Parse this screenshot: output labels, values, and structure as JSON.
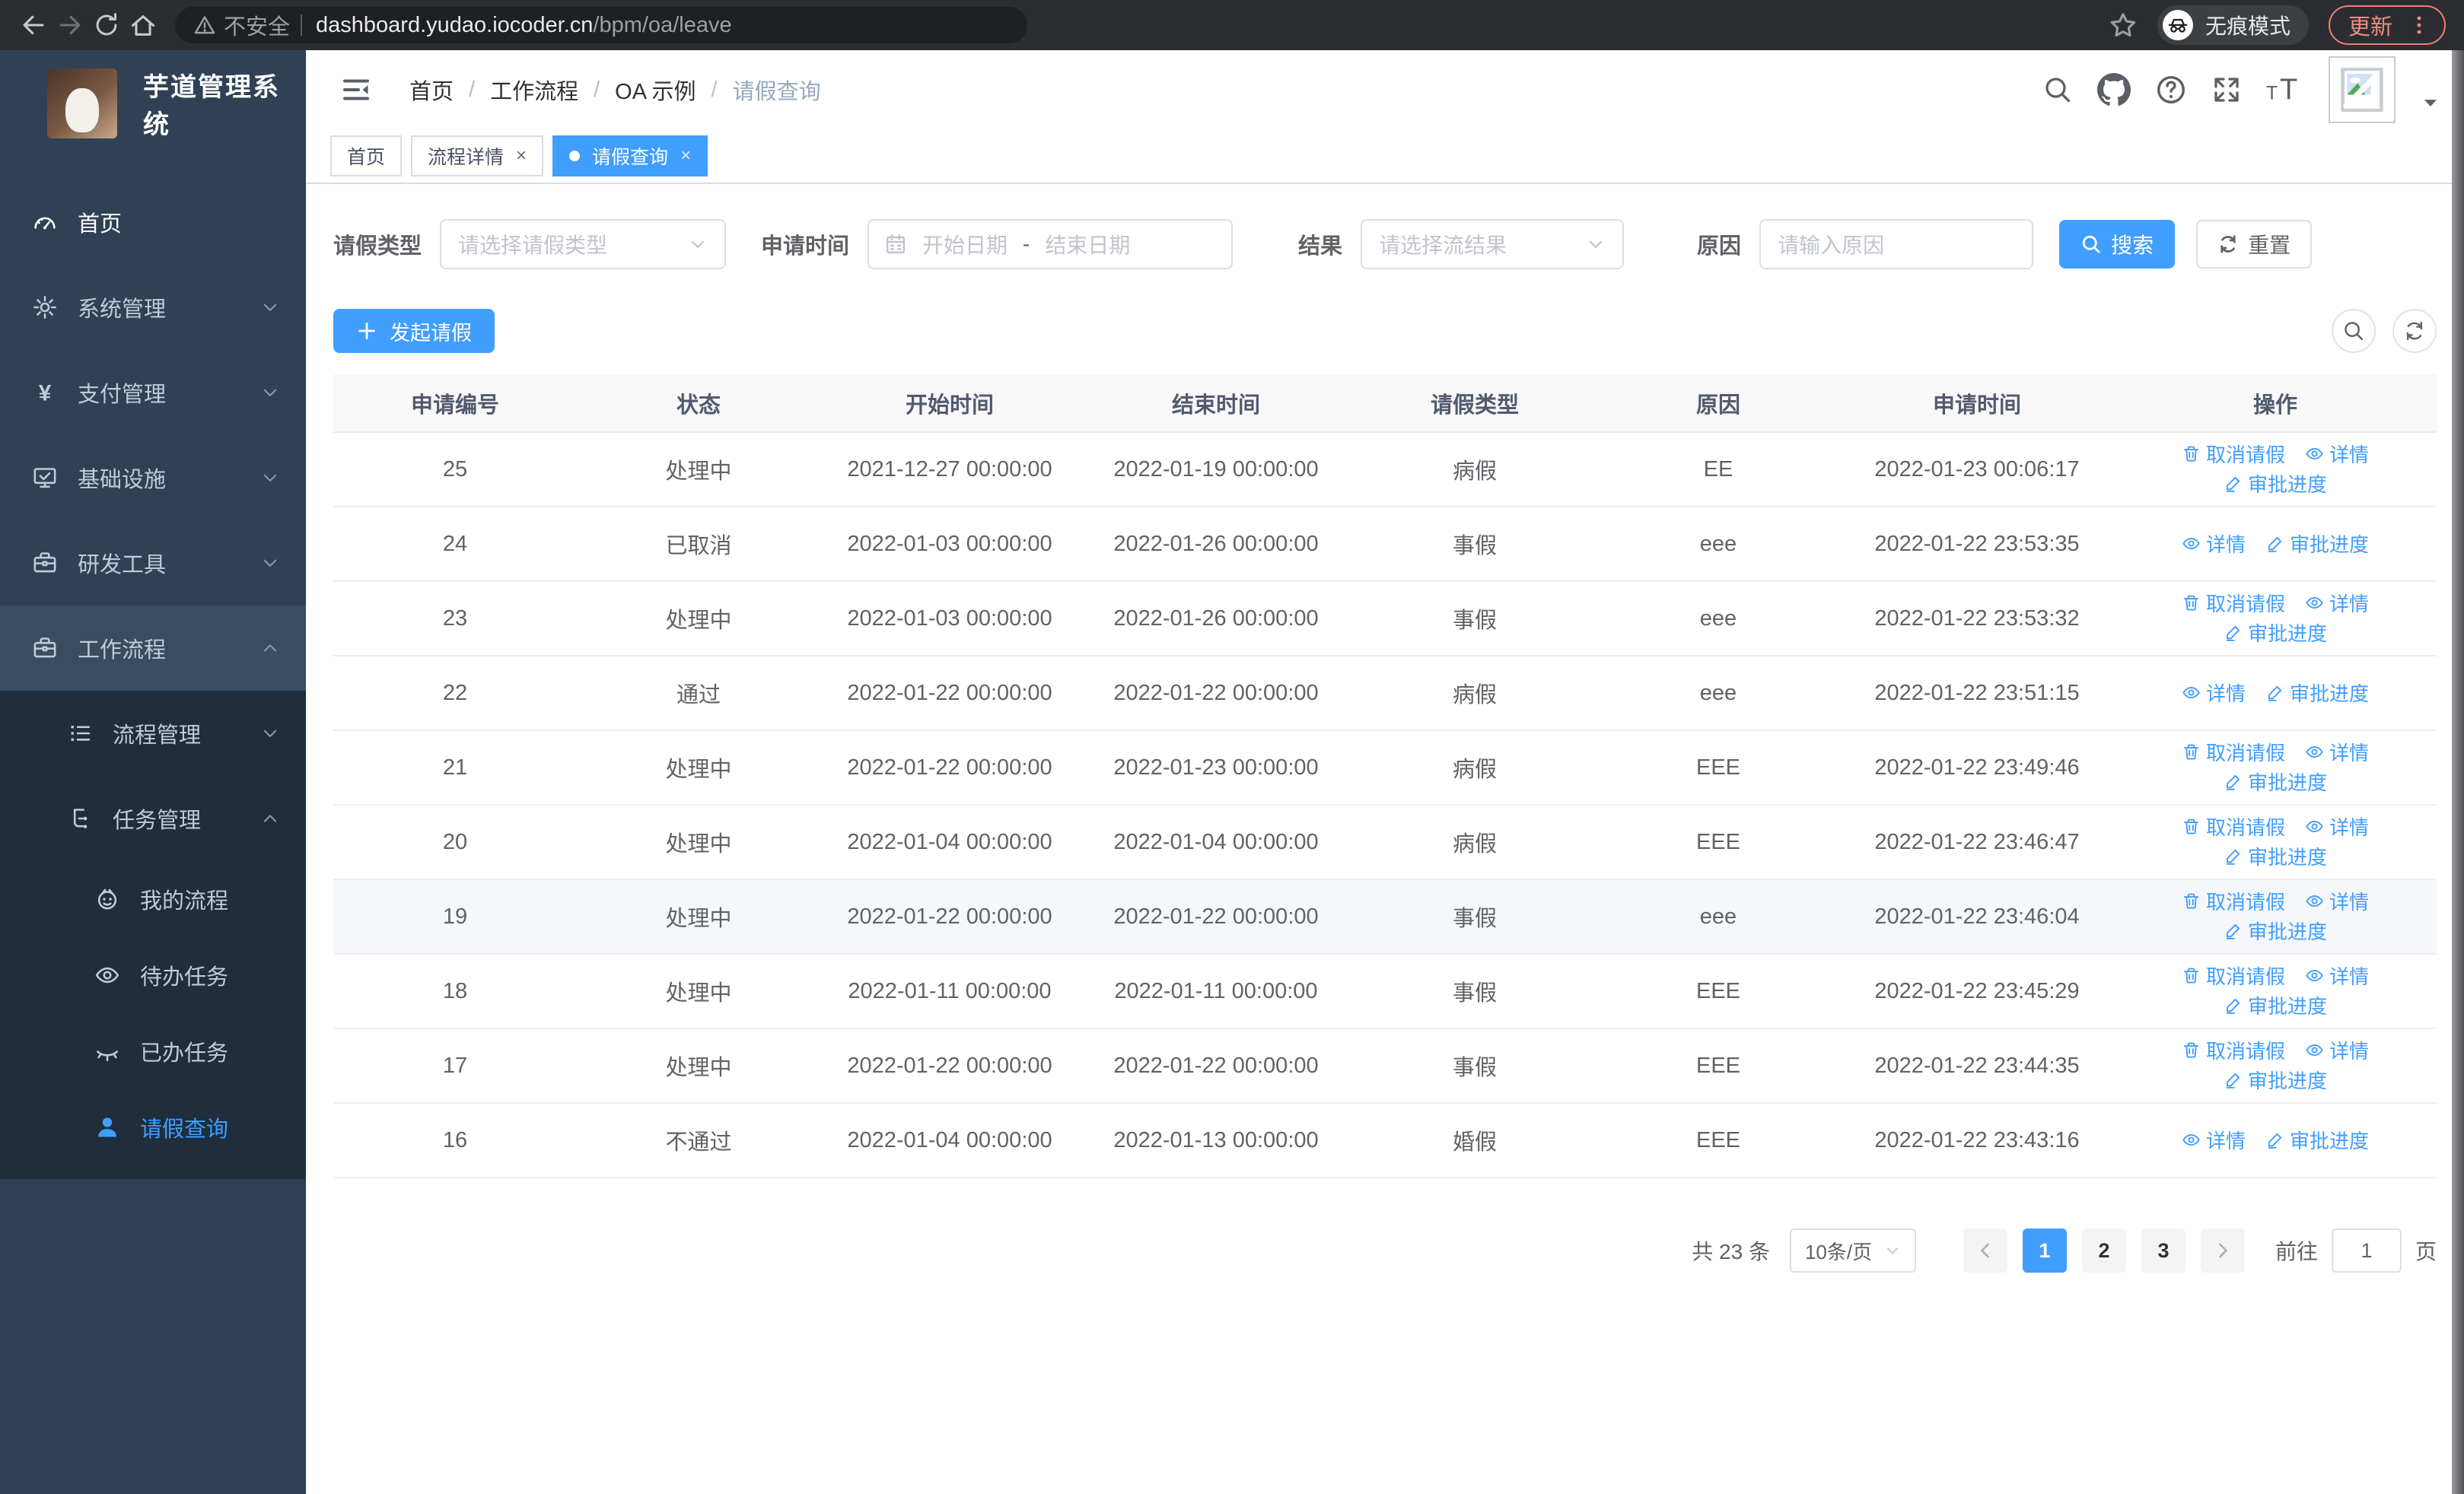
{
  "colors": {
    "accent": "#409eff",
    "sidebar_bg": "#304156",
    "submenu_bg": "#1f2d3d",
    "chrome_bg": "#2c2d30",
    "update_coral": "#f08b80",
    "table_header_bg": "#f8f8f9",
    "row_hover_bg": "#f5f7fa"
  },
  "browser": {
    "security_label": "不安全",
    "url_host": "dashboard.yudao.iocoder.cn",
    "url_path": "/bpm/oa/leave",
    "incognito_label": "无痕模式",
    "update_label": "更新"
  },
  "sidebar": {
    "title": "芋道管理系统",
    "items": [
      {
        "key": "home",
        "label": "首页",
        "icon": "gauge-icon",
        "level": 1,
        "chevron": null,
        "bright": true,
        "block": "top"
      },
      {
        "key": "system-management",
        "label": "系统管理",
        "icon": "gear-icon",
        "level": 1,
        "chevron": "down",
        "block": "top"
      },
      {
        "key": "payment-management",
        "label": "支付管理",
        "icon": "yen-icon",
        "level": 1,
        "chevron": "down",
        "block": "top"
      },
      {
        "key": "infrastructure",
        "label": "基础设施",
        "icon": "monitor-icon",
        "level": 1,
        "chevron": "down",
        "block": "top"
      },
      {
        "key": "dev-tools",
        "label": "研发工具",
        "icon": "toolbox-icon",
        "level": 1,
        "chevron": "down",
        "block": "top"
      },
      {
        "key": "workflow",
        "label": "工作流程",
        "icon": "briefcase-icon",
        "level": 1,
        "chevron": "up",
        "expanded": true,
        "block": "top"
      },
      {
        "key": "process-management",
        "label": "流程管理",
        "icon": "list-icon",
        "level": 2,
        "chevron": "down",
        "block": "sub"
      },
      {
        "key": "task-management",
        "label": "任务管理",
        "icon": "tree-icon",
        "level": 2,
        "chevron": "up",
        "block": "sub"
      },
      {
        "key": "my-process",
        "label": "我的流程",
        "icon": "face-icon",
        "level": 3,
        "chevron": null,
        "block": "sub"
      },
      {
        "key": "todo-tasks",
        "label": "待办任务",
        "icon": "eye-icon",
        "level": 3,
        "chevron": null,
        "block": "sub"
      },
      {
        "key": "done-tasks",
        "label": "已办任务",
        "icon": "eye-closed-icon",
        "level": 3,
        "chevron": null,
        "block": "sub"
      },
      {
        "key": "leave-query",
        "label": "请假查询",
        "icon": "user-icon",
        "level": 3,
        "chevron": null,
        "active": true,
        "block": "sub"
      }
    ]
  },
  "breadcrumb": {
    "items": [
      "首页",
      "工作流程",
      "OA 示例",
      "请假查询"
    ]
  },
  "tabs": [
    {
      "label": "首页",
      "closable": false,
      "active": false
    },
    {
      "label": "流程详情",
      "closable": true,
      "active": false
    },
    {
      "label": "请假查询",
      "closable": true,
      "active": true
    }
  ],
  "filters": {
    "leave_type": {
      "label": "请假类型",
      "placeholder": "请选择请假类型"
    },
    "apply_time": {
      "label": "申请时间",
      "start_placeholder": "开始日期",
      "separator": "-",
      "end_placeholder": "结束日期"
    },
    "result": {
      "label": "结果",
      "placeholder": "请选择流结果"
    },
    "reason": {
      "label": "原因",
      "placeholder": "请输入原因"
    },
    "search_label": "搜索",
    "reset_label": "重置"
  },
  "toolbar": {
    "create_label": "发起请假"
  },
  "table": {
    "columns": [
      "申请编号",
      "状态",
      "开始时间",
      "结束时间",
      "请假类型",
      "原因",
      "申请时间",
      "操作"
    ],
    "action_defs": {
      "cancel": {
        "label": "取消请假",
        "icon": "trash-icon"
      },
      "detail": {
        "label": "详情",
        "icon": "view-icon"
      },
      "progress": {
        "label": "审批进度",
        "icon": "edit-icon"
      }
    },
    "rows": [
      {
        "id": "25",
        "status": "处理中",
        "start": "2021-12-27 00:00:00",
        "end": "2022-01-19 00:00:00",
        "type": "病假",
        "reason": "EE",
        "apply": "2022-01-23 00:06:17",
        "actions": [
          "cancel",
          "detail",
          "progress"
        ],
        "highlighted": false
      },
      {
        "id": "24",
        "status": "已取消",
        "start": "2022-01-03 00:00:00",
        "end": "2022-01-26 00:00:00",
        "type": "事假",
        "reason": "eee",
        "apply": "2022-01-22 23:53:35",
        "actions": [
          "detail",
          "progress"
        ],
        "highlighted": false
      },
      {
        "id": "23",
        "status": "处理中",
        "start": "2022-01-03 00:00:00",
        "end": "2022-01-26 00:00:00",
        "type": "事假",
        "reason": "eee",
        "apply": "2022-01-22 23:53:32",
        "actions": [
          "cancel",
          "detail",
          "progress"
        ],
        "highlighted": false
      },
      {
        "id": "22",
        "status": "通过",
        "start": "2022-01-22 00:00:00",
        "end": "2022-01-22 00:00:00",
        "type": "病假",
        "reason": "eee",
        "apply": "2022-01-22 23:51:15",
        "actions": [
          "detail",
          "progress"
        ],
        "highlighted": false
      },
      {
        "id": "21",
        "status": "处理中",
        "start": "2022-01-22 00:00:00",
        "end": "2022-01-23 00:00:00",
        "type": "病假",
        "reason": "EEE",
        "apply": "2022-01-22 23:49:46",
        "actions": [
          "cancel",
          "detail",
          "progress"
        ],
        "highlighted": false
      },
      {
        "id": "20",
        "status": "处理中",
        "start": "2022-01-04 00:00:00",
        "end": "2022-01-04 00:00:00",
        "type": "病假",
        "reason": "EEE",
        "apply": "2022-01-22 23:46:47",
        "actions": [
          "cancel",
          "detail",
          "progress"
        ],
        "highlighted": false
      },
      {
        "id": "19",
        "status": "处理中",
        "start": "2022-01-22 00:00:00",
        "end": "2022-01-22 00:00:00",
        "type": "事假",
        "reason": "eee",
        "apply": "2022-01-22 23:46:04",
        "actions": [
          "cancel",
          "detail",
          "progress"
        ],
        "highlighted": true
      },
      {
        "id": "18",
        "status": "处理中",
        "start": "2022-01-11 00:00:00",
        "end": "2022-01-11 00:00:00",
        "type": "事假",
        "reason": "EEE",
        "apply": "2022-01-22 23:45:29",
        "actions": [
          "cancel",
          "detail",
          "progress"
        ],
        "highlighted": false
      },
      {
        "id": "17",
        "status": "处理中",
        "start": "2022-01-22 00:00:00",
        "end": "2022-01-22 00:00:00",
        "type": "事假",
        "reason": "EEE",
        "apply": "2022-01-22 23:44:35",
        "actions": [
          "cancel",
          "detail",
          "progress"
        ],
        "highlighted": false
      },
      {
        "id": "16",
        "status": "不通过",
        "start": "2022-01-04 00:00:00",
        "end": "2022-01-13 00:00:00",
        "type": "婚假",
        "reason": "EEE",
        "apply": "2022-01-22 23:43:16",
        "actions": [
          "detail",
          "progress"
        ],
        "highlighted": false
      }
    ]
  },
  "pagination": {
    "total_text": "共 23 条",
    "page_size": "10条/页",
    "pages": [
      "1",
      "2",
      "3"
    ],
    "active_page": "1",
    "goto_label": "前往",
    "goto_value": "1",
    "goto_suffix": "页"
  }
}
